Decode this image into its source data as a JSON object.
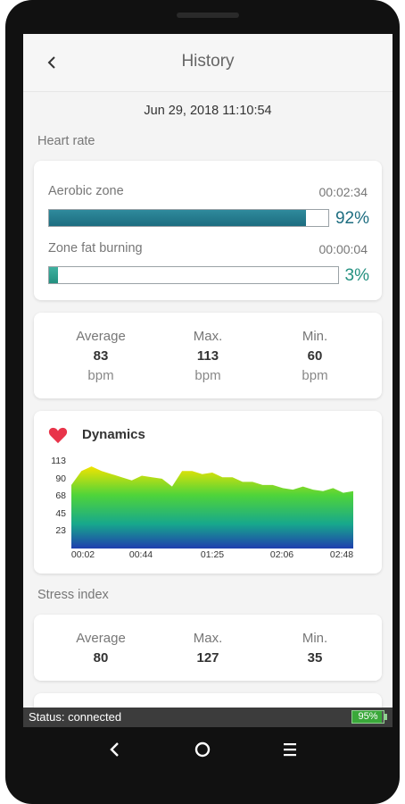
{
  "header": {
    "title": "History",
    "back_icon": "chevron-left-icon"
  },
  "date": "Jun 29, 2018 11:10:54",
  "heart_rate": {
    "section_label": "Heart rate",
    "zones": [
      {
        "name": "Aerobic zone",
        "time": "00:02:34",
        "percent_label": "92%",
        "percent": 92,
        "color": "#1d6d80"
      },
      {
        "name": "Zone fat burning",
        "time": "00:00:04",
        "percent_label": "3%",
        "percent": 3,
        "color": "#23907f"
      }
    ],
    "stats": [
      {
        "label": "Average",
        "value": "83",
        "unit": "bpm"
      },
      {
        "label": "Max.",
        "value": "113",
        "unit": "bpm"
      },
      {
        "label": "Min.",
        "value": "60",
        "unit": "bpm"
      }
    ]
  },
  "dynamics": {
    "title": "Dynamics",
    "icon": "heart-icon",
    "icon_color": "#e8344a",
    "chart_data": {
      "type": "area",
      "title": "Dynamics",
      "xlabel": "",
      "ylabel": "",
      "yticks": [
        "113",
        "90",
        "68",
        "45",
        "23"
      ],
      "xticks": [
        "00:02",
        "00:44",
        "01:25",
        "02:06",
        "02:48"
      ],
      "ylim": [
        0,
        113
      ],
      "x": [
        "00:02",
        "00:08",
        "00:14",
        "00:20",
        "00:26",
        "00:32",
        "00:38",
        "00:44",
        "00:50",
        "00:56",
        "01:02",
        "01:08",
        "01:14",
        "01:20",
        "01:26",
        "01:32",
        "01:38",
        "01:44",
        "01:50",
        "01:56",
        "02:02",
        "02:08",
        "02:14",
        "02:20",
        "02:26",
        "02:32",
        "02:38",
        "02:44",
        "02:48"
      ],
      "values": [
        82,
        100,
        106,
        100,
        96,
        92,
        88,
        94,
        92,
        90,
        80,
        100,
        100,
        96,
        98,
        92,
        92,
        86,
        86,
        82,
        82,
        78,
        76,
        80,
        76,
        74,
        78,
        72,
        74
      ],
      "grid": false,
      "gradient_colors": [
        "#f2e300",
        "#4fd43a",
        "#17a88c",
        "#1f3fae"
      ]
    }
  },
  "stress": {
    "section_label": "Stress index",
    "stats": [
      {
        "label": "Average",
        "value": "80"
      },
      {
        "label": "Max.",
        "value": "127"
      },
      {
        "label": "Min.",
        "value": "35"
      }
    ]
  },
  "status_bar": {
    "text": "Status:  connected",
    "battery": "95%",
    "battery_level": 95
  },
  "nav": {
    "back_icon": "nav-back-icon",
    "home_icon": "nav-home-icon",
    "menu_icon": "nav-menu-icon"
  }
}
